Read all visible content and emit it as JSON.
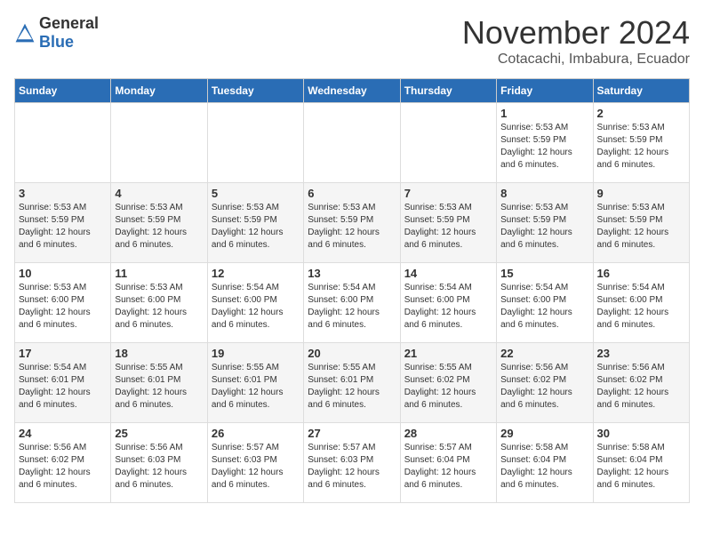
{
  "logo": {
    "text_general": "General",
    "text_blue": "Blue"
  },
  "title": {
    "month": "November 2024",
    "location": "Cotacachi, Imbabura, Ecuador"
  },
  "weekdays": [
    "Sunday",
    "Monday",
    "Tuesday",
    "Wednesday",
    "Thursday",
    "Friday",
    "Saturday"
  ],
  "weeks": [
    [
      {
        "day": "",
        "info": ""
      },
      {
        "day": "",
        "info": ""
      },
      {
        "day": "",
        "info": ""
      },
      {
        "day": "",
        "info": ""
      },
      {
        "day": "",
        "info": ""
      },
      {
        "day": "1",
        "info": "Sunrise: 5:53 AM\nSunset: 5:59 PM\nDaylight: 12 hours and 6 minutes."
      },
      {
        "day": "2",
        "info": "Sunrise: 5:53 AM\nSunset: 5:59 PM\nDaylight: 12 hours and 6 minutes."
      }
    ],
    [
      {
        "day": "3",
        "info": "Sunrise: 5:53 AM\nSunset: 5:59 PM\nDaylight: 12 hours and 6 minutes."
      },
      {
        "day": "4",
        "info": "Sunrise: 5:53 AM\nSunset: 5:59 PM\nDaylight: 12 hours and 6 minutes."
      },
      {
        "day": "5",
        "info": "Sunrise: 5:53 AM\nSunset: 5:59 PM\nDaylight: 12 hours and 6 minutes."
      },
      {
        "day": "6",
        "info": "Sunrise: 5:53 AM\nSunset: 5:59 PM\nDaylight: 12 hours and 6 minutes."
      },
      {
        "day": "7",
        "info": "Sunrise: 5:53 AM\nSunset: 5:59 PM\nDaylight: 12 hours and 6 minutes."
      },
      {
        "day": "8",
        "info": "Sunrise: 5:53 AM\nSunset: 5:59 PM\nDaylight: 12 hours and 6 minutes."
      },
      {
        "day": "9",
        "info": "Sunrise: 5:53 AM\nSunset: 5:59 PM\nDaylight: 12 hours and 6 minutes."
      }
    ],
    [
      {
        "day": "10",
        "info": "Sunrise: 5:53 AM\nSunset: 6:00 PM\nDaylight: 12 hours and 6 minutes."
      },
      {
        "day": "11",
        "info": "Sunrise: 5:53 AM\nSunset: 6:00 PM\nDaylight: 12 hours and 6 minutes."
      },
      {
        "day": "12",
        "info": "Sunrise: 5:54 AM\nSunset: 6:00 PM\nDaylight: 12 hours and 6 minutes."
      },
      {
        "day": "13",
        "info": "Sunrise: 5:54 AM\nSunset: 6:00 PM\nDaylight: 12 hours and 6 minutes."
      },
      {
        "day": "14",
        "info": "Sunrise: 5:54 AM\nSunset: 6:00 PM\nDaylight: 12 hours and 6 minutes."
      },
      {
        "day": "15",
        "info": "Sunrise: 5:54 AM\nSunset: 6:00 PM\nDaylight: 12 hours and 6 minutes."
      },
      {
        "day": "16",
        "info": "Sunrise: 5:54 AM\nSunset: 6:00 PM\nDaylight: 12 hours and 6 minutes."
      }
    ],
    [
      {
        "day": "17",
        "info": "Sunrise: 5:54 AM\nSunset: 6:01 PM\nDaylight: 12 hours and 6 minutes."
      },
      {
        "day": "18",
        "info": "Sunrise: 5:55 AM\nSunset: 6:01 PM\nDaylight: 12 hours and 6 minutes."
      },
      {
        "day": "19",
        "info": "Sunrise: 5:55 AM\nSunset: 6:01 PM\nDaylight: 12 hours and 6 minutes."
      },
      {
        "day": "20",
        "info": "Sunrise: 5:55 AM\nSunset: 6:01 PM\nDaylight: 12 hours and 6 minutes."
      },
      {
        "day": "21",
        "info": "Sunrise: 5:55 AM\nSunset: 6:02 PM\nDaylight: 12 hours and 6 minutes."
      },
      {
        "day": "22",
        "info": "Sunrise: 5:56 AM\nSunset: 6:02 PM\nDaylight: 12 hours and 6 minutes."
      },
      {
        "day": "23",
        "info": "Sunrise: 5:56 AM\nSunset: 6:02 PM\nDaylight: 12 hours and 6 minutes."
      }
    ],
    [
      {
        "day": "24",
        "info": "Sunrise: 5:56 AM\nSunset: 6:02 PM\nDaylight: 12 hours and 6 minutes."
      },
      {
        "day": "25",
        "info": "Sunrise: 5:56 AM\nSunset: 6:03 PM\nDaylight: 12 hours and 6 minutes."
      },
      {
        "day": "26",
        "info": "Sunrise: 5:57 AM\nSunset: 6:03 PM\nDaylight: 12 hours and 6 minutes."
      },
      {
        "day": "27",
        "info": "Sunrise: 5:57 AM\nSunset: 6:03 PM\nDaylight: 12 hours and 6 minutes."
      },
      {
        "day": "28",
        "info": "Sunrise: 5:57 AM\nSunset: 6:04 PM\nDaylight: 12 hours and 6 minutes."
      },
      {
        "day": "29",
        "info": "Sunrise: 5:58 AM\nSunset: 6:04 PM\nDaylight: 12 hours and 6 minutes."
      },
      {
        "day": "30",
        "info": "Sunrise: 5:58 AM\nSunset: 6:04 PM\nDaylight: 12 hours and 6 minutes."
      }
    ]
  ]
}
